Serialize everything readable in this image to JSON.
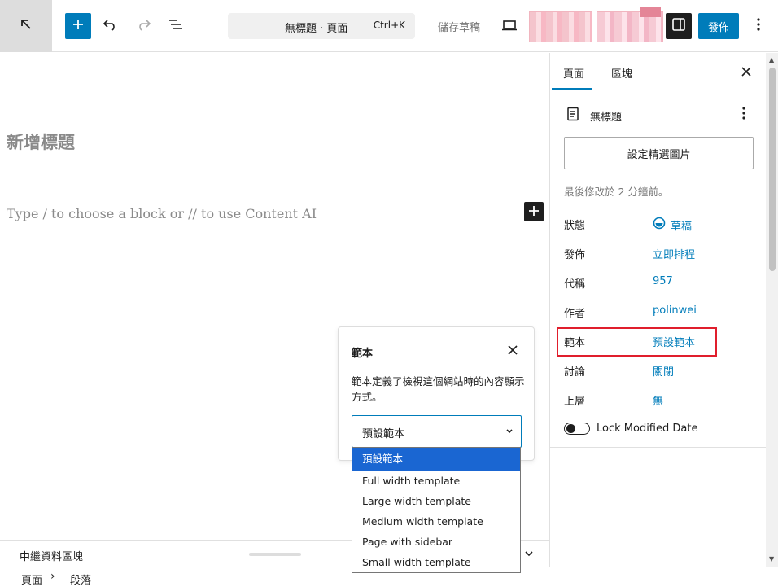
{
  "topbar": {
    "command_title": "無標題 · 頁面",
    "command_shortcut": "Ctrl+K",
    "save_draft_label": "儲存草稿",
    "publish_label": "發佈",
    "icons": [
      "wordpress-back-icon",
      "plus-icon",
      "undo-icon",
      "redo-icon",
      "list-view-icon",
      "desktop-icon",
      "sidebar-icon",
      "more-vertical-icon"
    ]
  },
  "editor": {
    "title_placeholder": "新增標題",
    "block_placeholder": "Type / to choose a block or // to use Content AI"
  },
  "template_popover": {
    "title": "範本",
    "description": "範本定義了檢視這個網站時的內容顯示方式。",
    "selected": "預設範本",
    "options": [
      "預設範本",
      "Full width template",
      "Large width template",
      "Medium width template",
      "Page with sidebar",
      "Small width template"
    ]
  },
  "meta_box": {
    "title": "中繼資料區塊"
  },
  "breadcrumb": {
    "items": [
      "頁面",
      "段落"
    ],
    "separator": "›"
  },
  "sidebar": {
    "tabs": [
      "頁面",
      "區塊"
    ],
    "active_tab": "頁面",
    "doc_title": "無標題",
    "featured_image_button": "設定精選圖片",
    "last_modified": "最後修改於 2 分鐘前。",
    "rows": [
      {
        "label": "狀態",
        "value": "草稿"
      },
      {
        "label": "發佈",
        "value": "立即排程"
      },
      {
        "label": "代稱",
        "value": "957"
      },
      {
        "label": "作者",
        "value": "polinwei"
      },
      {
        "label": "範本",
        "value": "預設範本"
      },
      {
        "label": "討論",
        "value": "關閉"
      },
      {
        "label": "上層",
        "value": "無"
      }
    ],
    "lock_modified_label": "Lock Modified Date",
    "lock_modified_on": false
  },
  "colors": {
    "accent": "#007cba",
    "dark": "#1e1e1e",
    "highlight_border": "#e01e2c",
    "dropdown_selected": "#1a66d2"
  }
}
